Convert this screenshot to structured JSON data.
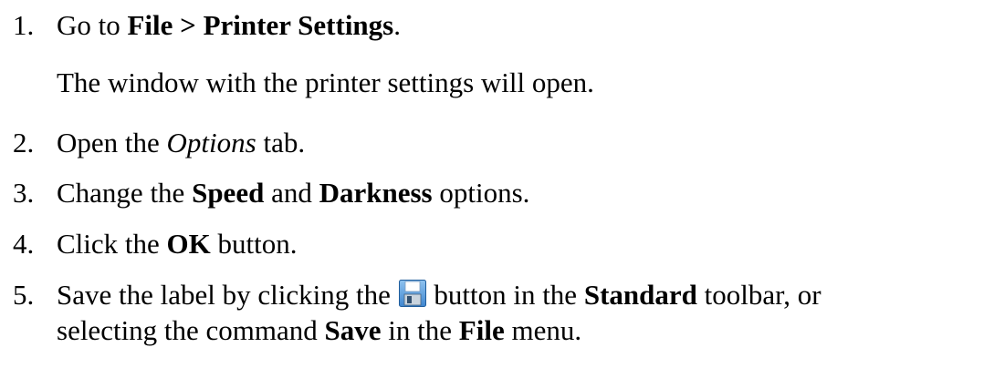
{
  "steps": [
    {
      "number": "1.",
      "parts": {
        "a": "Go to ",
        "b": "File > Printer Settings",
        "c": "."
      },
      "note": "The window with the printer settings will open."
    },
    {
      "number": "2.",
      "parts": {
        "a": "Open the ",
        "b": "Options",
        "c": " tab."
      }
    },
    {
      "number": "3.",
      "parts": {
        "a": "Change the ",
        "b": "Speed",
        "c": " and ",
        "d": "Darkness",
        "e": " options."
      }
    },
    {
      "number": "4.",
      "parts": {
        "a": "Click the ",
        "b": "OK",
        "c": " button."
      }
    },
    {
      "number": "5.",
      "parts": {
        "a": "Save the label by clicking the ",
        "icon": "save-icon",
        "b": " button in the ",
        "c": "Standard",
        "d": " toolbar, or",
        "e": "selecting the command ",
        "f": "Save",
        "g": " in the ",
        "h": "File",
        "i": " menu."
      }
    }
  ]
}
